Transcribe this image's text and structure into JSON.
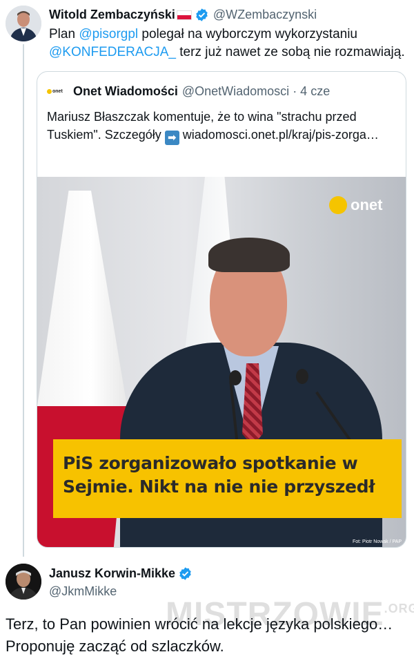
{
  "tweet1": {
    "name": "Witold Zembaczyński",
    "handle": "@WZembaczynski",
    "text_before": "Plan ",
    "mention1": "@pisorgpl",
    "text_mid": " polegał na wyborczym wykorzystaniu ",
    "mention2": "@KONFEDERACJA_",
    "text_after": "  terz już nawet ze sobą nie rozmawiają."
  },
  "quote": {
    "logo_mini": "onet",
    "name": "Onet Wiadomości",
    "handle": "@OnetWiadomosci",
    "time": "· 4 cze",
    "text_before": "Mariusz Błaszczak komentuje, że to wina \"strachu przed Tuskiem\". Szczegóły ",
    "arrow": "➡",
    "link": " wiadomosci.onet.pl/kraj/pis-zorga…",
    "image": {
      "logo": "onet",
      "banner_line1": "PiS zorganizowało spotkanie w",
      "banner_line2": "Sejmie. Nikt na nie nie przyszedł",
      "credit": "Fot: Piotr Nowak / PAP"
    }
  },
  "tweet2": {
    "name": "Janusz Korwin-Mikke",
    "handle": "@JkmMikke",
    "text": "Terz, to Pan powinien wrócić na lekcje języka polskiego… Proponuję zacząć od szlaczków."
  },
  "watermark": {
    "main": "MISTRZOWIE",
    "suffix": ".ORG"
  },
  "colors": {
    "link": "#1d9bf0",
    "verified": "#1d9bf0",
    "banner": "#f7c200",
    "onet_yellow": "#f5c400"
  }
}
